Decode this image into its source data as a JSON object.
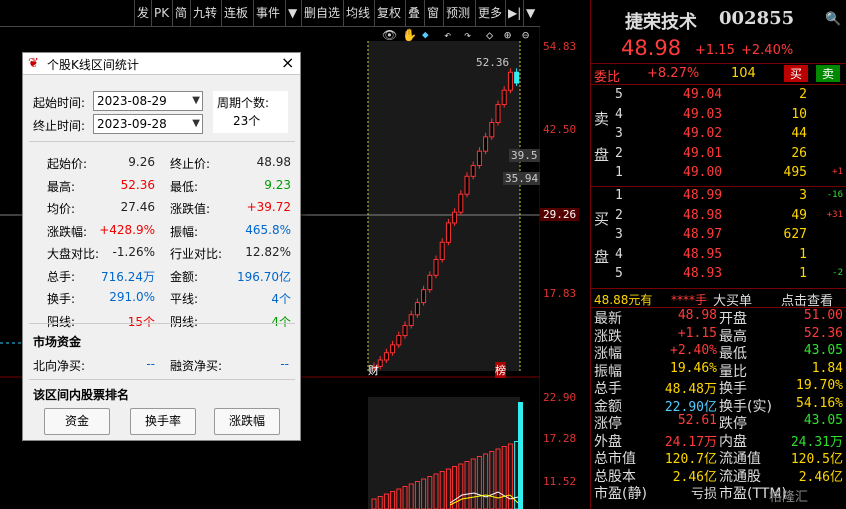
{
  "toolbar": {
    "items": [
      "发",
      "PK",
      "简",
      "九转",
      "连板",
      "事件",
      "▼",
      "删自选",
      "均线",
      "复权",
      "叠",
      "窗",
      "预测",
      "更多",
      "▶|",
      "▼"
    ]
  },
  "chart": {
    "price_labels": [
      "54.83",
      "42.50",
      "29.26",
      "17.83",
      "22.90",
      "17.28",
      "11.52"
    ],
    "high_label": "52.36",
    "label_a": "39.5",
    "label_b": "35.94",
    "marker_left": "财",
    "marker_right": "榜",
    "icons": [
      "eye",
      "hand",
      "diamond",
      "diamond",
      "undo",
      "redo",
      "diamond",
      "zoom-in",
      "zoom-out"
    ]
  },
  "dialog": {
    "title": "个股K线区间统计",
    "start_label": "起始时间:",
    "start_value": "2023-08-29",
    "end_label": "终止时间:",
    "end_value": "2023-09-28",
    "period_label": "周期个数:",
    "period_value": "23个",
    "rows": [
      {
        "l1": "起始价:",
        "v1": "9.26",
        "c1": "vk",
        "l2": "终止价:",
        "v2": "48.98",
        "c2": "vk"
      },
      {
        "l1": "最高:",
        "v1": "52.36",
        "c1": "vr",
        "l2": "最低:",
        "v2": "9.23",
        "c2": "vg"
      },
      {
        "l1": "均价:",
        "v1": "27.46",
        "c1": "vk",
        "l2": "涨跌值:",
        "v2": "+39.72",
        "c2": "vr"
      },
      {
        "l1": "涨跌幅:",
        "v1": "+428.9%",
        "c1": "vr",
        "l2": "振幅:",
        "v2": "465.8%",
        "c2": "vb"
      },
      {
        "l1": "大盘对比:",
        "v1": "-1.26%",
        "c1": "vk",
        "l2": "行业对比:",
        "v2": "12.82%",
        "c2": "vk"
      },
      {
        "l1": "总手:",
        "v1": "716.24万",
        "c1": "vb",
        "l2": "金额:",
        "v2": "196.70亿",
        "c2": "vb"
      },
      {
        "l1": "换手:",
        "v1": "291.0%",
        "c1": "vb",
        "l2": "平线:",
        "v2": "4个",
        "c2": "vb"
      },
      {
        "l1": "阳线:",
        "v1": "15个",
        "c1": "vr",
        "l2": "阴线:",
        "v2": "4个",
        "c2": "vg"
      }
    ],
    "fund_header": "市场资金",
    "north_label": "北向净买:",
    "north_value": "--",
    "margin_label": "融资净买:",
    "margin_value": "--",
    "rank_header": "该区间内股票排名",
    "buttons": [
      "资金",
      "换手率",
      "涨跌幅"
    ]
  },
  "quote": {
    "name": "捷荣技术",
    "code": "002855",
    "price": "48.98",
    "change": "+1.15",
    "pct": "+2.40%",
    "weibi_label": "委比",
    "weibi_value": "+8.27%",
    "weibi_count": "104",
    "buy_btn": "买",
    "sell_btn": "卖",
    "sell_side_label": [
      "卖",
      "盘"
    ],
    "buy_side_label": [
      "买",
      "盘"
    ],
    "asks": [
      {
        "n": "5",
        "p": "49.04",
        "v": "2",
        "d": ""
      },
      {
        "n": "4",
        "p": "49.03",
        "v": "10",
        "d": ""
      },
      {
        "n": "3",
        "p": "49.02",
        "v": "44",
        "d": ""
      },
      {
        "n": "2",
        "p": "49.01",
        "v": "26",
        "d": ""
      },
      {
        "n": "1",
        "p": "49.00",
        "v": "495",
        "d": "+1"
      }
    ],
    "bids": [
      {
        "n": "1",
        "p": "48.99",
        "v": "3",
        "d": "-16"
      },
      {
        "n": "2",
        "p": "48.98",
        "v": "49",
        "d": "+31"
      },
      {
        "n": "3",
        "p": "48.97",
        "v": "627",
        "d": ""
      },
      {
        "n": "4",
        "p": "48.95",
        "v": "1",
        "d": ""
      },
      {
        "n": "5",
        "p": "48.93",
        "v": "1",
        "d": "-2"
      }
    ],
    "bigorder": {
      "price": "48.88元有",
      "stars": "****手",
      "label": "大买单",
      "link": "点击查看"
    },
    "stats": [
      {
        "l1": "最新",
        "v1": "48.98",
        "c1": "r",
        "l2": "开盘",
        "v2": "51.00",
        "c2": "r"
      },
      {
        "l1": "涨跌",
        "v1": "+1.15",
        "c1": "r",
        "l2": "最高",
        "v2": "52.36",
        "c2": "r"
      },
      {
        "l1": "涨幅",
        "v1": "+2.40%",
        "c1": "r",
        "l2": "最低",
        "v2": "43.05",
        "c2": "gr"
      },
      {
        "l1": "振幅",
        "v1": "19.46%",
        "c1": "y",
        "l2": "量比",
        "v2": "1.84",
        "c2": "y"
      },
      {
        "l1": "总手",
        "v1": "48.48万",
        "c1": "y",
        "l2": "换手",
        "v2": "19.70%",
        "c2": "y"
      },
      {
        "l1": "金额",
        "v1": "22.90亿",
        "c1": "c",
        "l2": "换手(实)",
        "v2": "54.16%",
        "c2": "y"
      },
      {
        "l1": "涨停",
        "v1": "52.61",
        "c1": "r",
        "l2": "跌停",
        "v2": "43.05",
        "c2": "gr"
      },
      {
        "l1": "外盘",
        "v1": "24.17万",
        "c1": "r",
        "l2": "内盘",
        "v2": "24.31万",
        "c2": "gr"
      },
      {
        "l1": "总市值",
        "v1": "120.7亿",
        "c1": "y",
        "l2": "流通值",
        "v2": "120.5亿",
        "c2": "y"
      },
      {
        "l1": "总股本",
        "v1": "2.46亿",
        "c1": "y",
        "l2": "流通股",
        "v2": "2.46亿",
        "c2": "y"
      },
      {
        "l1": "市盈(静)",
        "v1": "亏损",
        "c1": "w",
        "l2": "市盈(TTM)",
        "v2": "",
        "c2": "w"
      }
    ],
    "watermark": "格隆汇"
  }
}
